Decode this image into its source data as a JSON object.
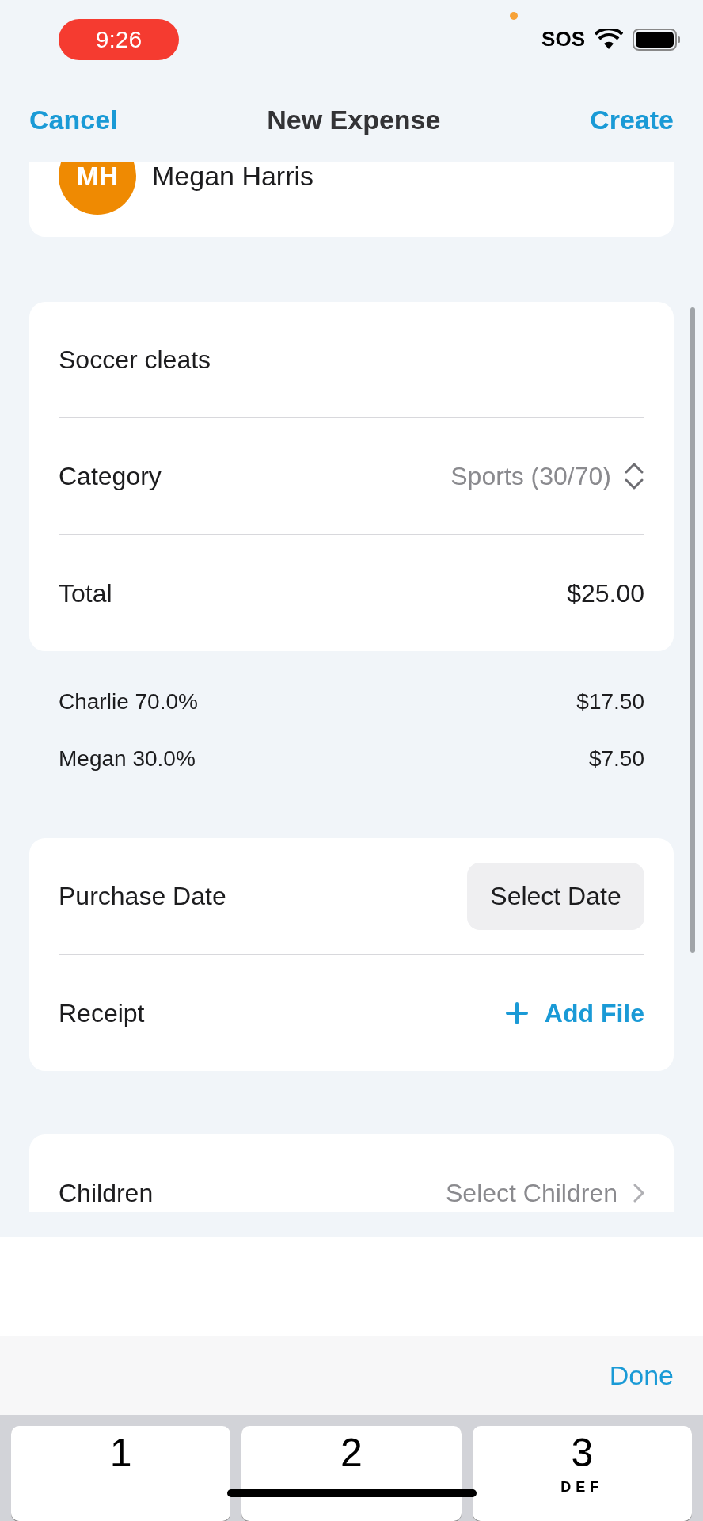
{
  "status_bar": {
    "time": "9:26",
    "sos": "SOS"
  },
  "nav": {
    "cancel": "Cancel",
    "title": "New Expense",
    "create": "Create"
  },
  "payer": {
    "initials": "MH",
    "name": "Megan Harris"
  },
  "details": [
    {
      "kind": "text",
      "label": "Soccer cleats"
    },
    {
      "kind": "picker",
      "label": "Category",
      "value": "Sports (30/70)"
    },
    {
      "kind": "value",
      "label": "Total",
      "value": "$25.00"
    }
  ],
  "split": [
    {
      "label": "Charlie 70.0%",
      "amount": "$17.50"
    },
    {
      "label": "Megan 30.0%",
      "amount": "$7.50"
    }
  ],
  "extras": [
    {
      "kind": "date",
      "label": "Purchase Date",
      "action": "Select Date"
    },
    {
      "kind": "file",
      "label": "Receipt",
      "action": "Add File"
    }
  ],
  "children": {
    "label": "Children",
    "placeholder": "Select Children"
  },
  "toolbar": {
    "done": "Done"
  },
  "keys": [
    {
      "digit": "1"
    },
    {
      "digit": "2"
    },
    {
      "digit": "3",
      "letters": "DEF"
    }
  ]
}
